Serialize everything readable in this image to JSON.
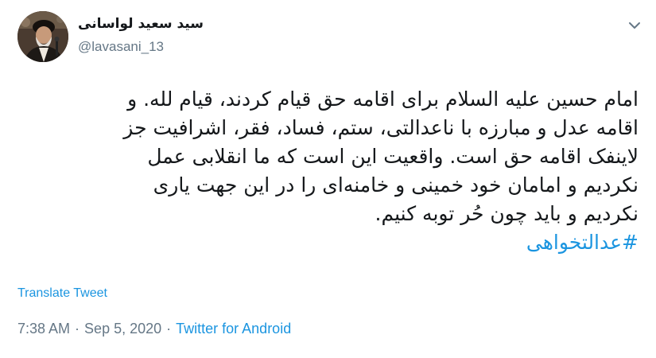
{
  "user": {
    "display_name": "سید سعید لواسانی",
    "handle": "@lavasani_13"
  },
  "icons": {
    "avatar": "profile-photo",
    "menu": "chevron-down-icon"
  },
  "tweet": {
    "lines": [
      "امام حسین علیه السلام برای اقامه حق قیام کردند، قیام لله. و",
      "اقامه عدل و مبارزه با ناعدالتی، ستم، فساد، فقر، اشرافیت جز",
      "لاینفک اقامه حق است. واقعیت این است که ما انقلابی عمل",
      "نکردیم و امامان خود خمینی و خامنه‌ای را در این جهت یاری",
      "نکردیم و  باید چون حُر توبه کنیم."
    ],
    "hashtag": "#عدالتخواهی"
  },
  "actions": {
    "translate_label": "Translate Tweet"
  },
  "meta": {
    "time": "7:38 AM",
    "separator": "·",
    "date": "Sep 5, 2020",
    "source": "Twitter for Android"
  },
  "colors": {
    "link": "#1b95e0",
    "secondary_text": "#657786",
    "primary_text": "#14171a"
  }
}
